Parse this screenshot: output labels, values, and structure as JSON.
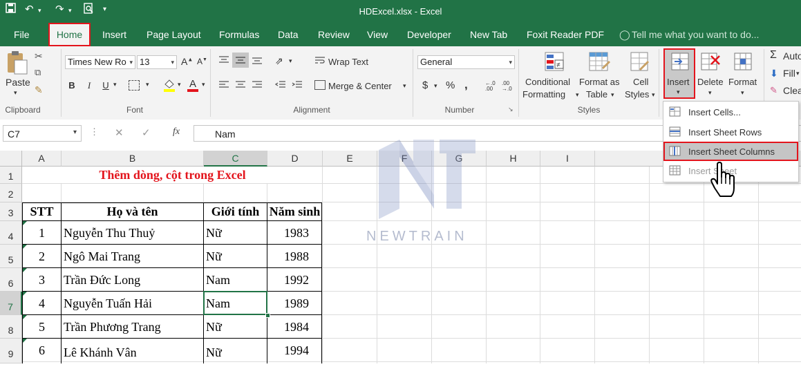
{
  "title_bar": {
    "title": "HDExcel.xlsx - Excel",
    "qat": [
      "save-icon",
      "undo-icon",
      "redo-icon",
      "print-preview-icon",
      "customize-icon"
    ]
  },
  "tabs": [
    "File",
    "Home",
    "Insert",
    "Page Layout",
    "Formulas",
    "Data",
    "Review",
    "View",
    "Developer",
    "New Tab",
    "Foxit Reader PDF"
  ],
  "tell_me": "Tell me what you want to do...",
  "ribbon": {
    "clipboard": {
      "paste": "Paste",
      "group": "Clipboard"
    },
    "font": {
      "name": "Times New Ro",
      "size": "13",
      "group": "Font",
      "bold": "B",
      "italic": "I",
      "underline": "U"
    },
    "alignment": {
      "wrap": "Wrap Text",
      "merge": "Merge & Center",
      "group": "Alignment"
    },
    "number": {
      "format": "General",
      "group": "Number",
      "currency": "$",
      "percent": "%",
      "comma": ","
    },
    "styles": {
      "conditional": [
        "Conditional",
        "Formatting"
      ],
      "format_table": [
        "Format as",
        "Table"
      ],
      "cell_styles": [
        "Cell",
        "Styles"
      ],
      "group": "Styles"
    },
    "cells": {
      "insert": "Insert",
      "delete": "Delete",
      "format": "Format"
    },
    "editing": {
      "autosum": "Auto",
      "fill": "Fill",
      "clear": "Clea"
    }
  },
  "formula_bar": {
    "name_box": "C7",
    "fx": "fx",
    "value": "Nam"
  },
  "columns": [
    "A",
    "B",
    "C",
    "D",
    "E",
    "F",
    "G",
    "H",
    "I"
  ],
  "rows": [
    "1",
    "2",
    "3",
    "4",
    "5",
    "6",
    "7",
    "8",
    "9"
  ],
  "sheet": {
    "title": "Thêm dòng, cột trong Excel",
    "headers": [
      "STT",
      "Họ và tên",
      "Giới tính",
      "Năm sinh"
    ],
    "data": [
      [
        "1",
        "Nguyễn Thu Thuỷ",
        "Nữ",
        "1983"
      ],
      [
        "2",
        "Ngô Mai Trang",
        "Nữ",
        "1988"
      ],
      [
        "3",
        "Trần Đức Long",
        "Nam",
        "1992"
      ],
      [
        "4",
        "Nguyễn Tuấn Hải",
        "Nam",
        "1989"
      ],
      [
        "5",
        "Trần Phương Trang",
        "Nữ",
        "1984"
      ],
      [
        "6",
        "Lê Khánh Vân",
        "Nữ",
        "1994"
      ]
    ]
  },
  "dropdown": [
    "Insert Cells...",
    "Insert Sheet Rows",
    "Insert Sheet Columns",
    "Insert Sheet"
  ],
  "watermark": "NEWTRAIN",
  "colors": {
    "excel_green": "#217346",
    "highlight_red": "#e3141c",
    "title_red": "#e3141c"
  }
}
